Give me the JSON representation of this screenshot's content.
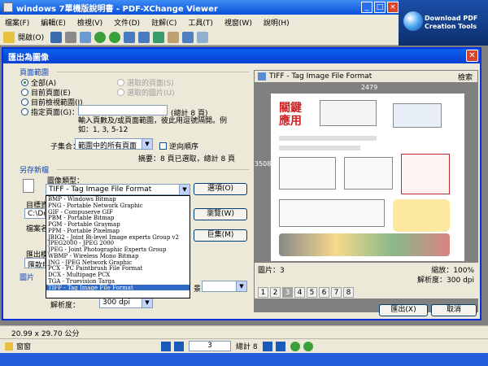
{
  "app": {
    "title": "windows 7單機版說明書 - PDF-XChange Viewer",
    "promo_line1": "Download PDF",
    "promo_line2": "Creation Tools"
  },
  "menu": [
    "檔案(F)",
    "編輯(E)",
    "檢視(V)",
    "文件(D)",
    "註解(C)",
    "工具(T)",
    "視窗(W)",
    "說明(H)"
  ],
  "toolbar": {
    "open_label": "開啟(O)"
  },
  "dialog": {
    "title": "匯出為圖像",
    "close": "✕",
    "page_range": {
      "label": "頁面範圍",
      "all": "全部(A)",
      "current": "目前頁面(E)",
      "current_view": "目前檢視範圍(I)",
      "specify": "指定頁面(G)：",
      "specify_value": "",
      "total": "(總計 8 頁)",
      "selected_pages": "選取的頁面(S)",
      "selected_images": "選取的圖片(U)",
      "hint": "輸入頁數及/或頁面範圍，彼此用逗號隔開。例如：1, 3, 5-12",
      "subset_label": "子集合：",
      "subset_value": "範圍中的所有頁面",
      "reverse": "逆向順序",
      "summary": "摘要：8 頁已選取，總計 8 頁"
    },
    "save_as": {
      "label": "另存新檔",
      "image_type_label": "圖像類型：",
      "image_type_value": "TIFF - Tag Image File Format",
      "options_button": "選項(O)",
      "target_label": "目標資",
      "target_value": "C:\\Doc",
      "browse_button": "瀏覽(W)",
      "filename_label": "檔案名",
      "macro_button": "巨集(M)",
      "export_label": "匯出模",
      "export_value": "匯款所"
    },
    "image": {
      "label": "圖片",
      "color_label": "景",
      "resolution_label": "解析度：",
      "resolution_value": "300 dpi"
    },
    "dropdown_items": [
      "BMP - Windows Bitmap",
      "PNG - Portable Network Graphic",
      "GIF - Compuserve GIF",
      "PBM - Portable Bitmap",
      "PGM - Portable Graymap",
      "PPM - Portable Pixelmap",
      "JBIG2 - Joint Bi-level Image experts Group v2",
      "JPEG2000 - JPEG 2000",
      "JPEG - Joint Photographic Experts Group",
      "WBMP - Wireless Mono Bitmap",
      "JNG - JPEG Network Graphic",
      "PCX - PC Paintbrush File Format",
      "DCX - Multipage PCX",
      "TGA - Truevision Targa",
      "TIFF - Tag Image File Format"
    ],
    "dropdown_selected_index": 14,
    "preview": {
      "header": "TIFF - Tag Image File Format",
      "header_right": "檢索",
      "width": "2479",
      "height": "3508",
      "image_label": "圖片：3",
      "zoom": "縮放：100%",
      "resolution": "解析度：300 dpi",
      "pages": [
        "1",
        "2",
        "3",
        "4",
        "5",
        "6",
        "7",
        "8"
      ],
      "current_page_index": 2,
      "page_heading": "關鍵應用"
    },
    "export_button": "匯出(X)",
    "cancel_button": "取消"
  },
  "status": {
    "page_size": "20.99 x 29.70 公分"
  },
  "nav": {
    "pane_label": "窗窗",
    "page_value": "3",
    "total": "總計 8"
  },
  "colors": {
    "title_blue": "#0a5fef",
    "dialog_bg": "#ece9d8",
    "selection": "#316ac5",
    "group_label": "#0a3fb0"
  }
}
